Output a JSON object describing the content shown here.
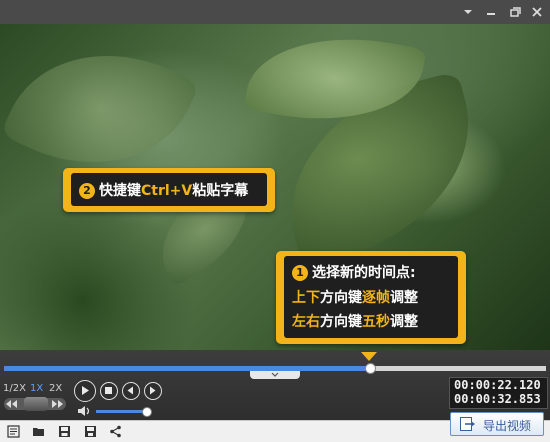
{
  "window": {
    "controls": [
      "dropdown-icon",
      "minimize-icon",
      "restore-icon",
      "close-icon"
    ]
  },
  "video": {
    "callout1": {
      "number": "2",
      "text_before": "快捷键",
      "hotkey": "Ctrl+V",
      "text_after": "粘贴字幕"
    },
    "callout2": {
      "number": "1",
      "title": "选择新的时间点:",
      "line1": {
        "part1": "上下",
        "part2": "方向键",
        "part3": "逐帧",
        "part4": "调整"
      },
      "line2": {
        "part1": "左右",
        "part2": "方向键",
        "part3": "五秒",
        "part4": "调整"
      }
    }
  },
  "timeline": {
    "progress": 0.675
  },
  "speed": {
    "options": [
      "1/2X",
      "1X",
      "2X"
    ],
    "selected": "1X"
  },
  "volume": {
    "level": 0.95
  },
  "time": {
    "current": "00:00:22.120",
    "total": "00:00:32.853"
  },
  "toolbar": {
    "export_label": "导出视频"
  },
  "colors": {
    "accent": "#f2b418",
    "progress": "#4d88e0"
  }
}
